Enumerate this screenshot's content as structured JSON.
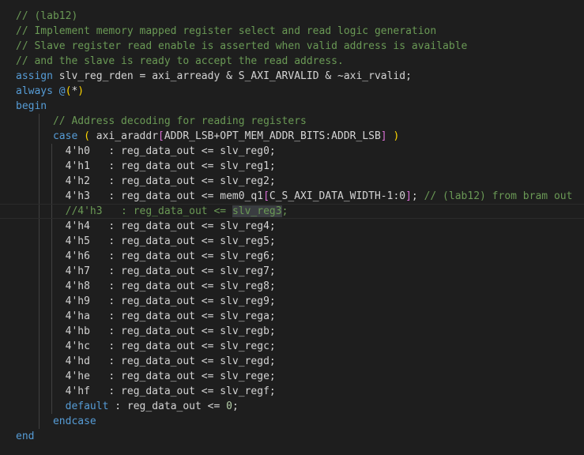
{
  "editor": {
    "lines": [
      {
        "indent": 0,
        "tokens": [
          {
            "t": "// (lab12)",
            "c": "com"
          }
        ]
      },
      {
        "indent": 0,
        "tokens": [
          {
            "t": "// Implement memory mapped register select and read logic generation",
            "c": "com"
          }
        ]
      },
      {
        "indent": 0,
        "tokens": [
          {
            "t": "// Slave register read enable is asserted when valid address is available",
            "c": "com"
          }
        ]
      },
      {
        "indent": 0,
        "tokens": [
          {
            "t": "// and the slave is ready to accept the read address.",
            "c": "com"
          }
        ]
      },
      {
        "indent": 0,
        "tokens": [
          {
            "t": "assign",
            "c": "kw"
          },
          {
            "t": " slv_reg_rden = axi_arready & S_AXI_ARVALID & ~axi_rvalid;",
            "c": "pl"
          }
        ]
      },
      {
        "indent": 0,
        "tokens": [
          {
            "t": "always",
            "c": "kw"
          },
          {
            "t": " ",
            "c": "pl"
          },
          {
            "t": "@",
            "c": "kw"
          },
          {
            "t": "(",
            "c": "br"
          },
          {
            "t": "*",
            "c": "pl"
          },
          {
            "t": ")",
            "c": "br"
          }
        ]
      },
      {
        "indent": 0,
        "tokens": [
          {
            "t": "begin",
            "c": "kw"
          }
        ]
      },
      {
        "indent": 1,
        "tokens": [
          {
            "t": "      // Address decoding for reading registers",
            "c": "com"
          }
        ]
      },
      {
        "indent": 1,
        "tokens": [
          {
            "t": "      ",
            "c": "pl"
          },
          {
            "t": "case",
            "c": "kw"
          },
          {
            "t": " ",
            "c": "pl"
          },
          {
            "t": "(",
            "c": "br"
          },
          {
            "t": " axi_araddr",
            "c": "pl"
          },
          {
            "t": "[",
            "c": "br2"
          },
          {
            "t": "ADDR_LSB+OPT_MEM_ADDR_BITS:ADDR_LSB",
            "c": "pl"
          },
          {
            "t": "]",
            "c": "br2"
          },
          {
            "t": " ",
            "c": "pl"
          },
          {
            "t": ")",
            "c": "br"
          }
        ]
      },
      {
        "indent": 2,
        "tokens": [
          {
            "t": "        4'h0   : reg_data_out <= slv_reg0;",
            "c": "pl"
          }
        ]
      },
      {
        "indent": 2,
        "tokens": [
          {
            "t": "        4'h1   : reg_data_out <= slv_reg1;",
            "c": "pl"
          }
        ]
      },
      {
        "indent": 2,
        "tokens": [
          {
            "t": "        4'h2   : reg_data_out <= slv_reg2;",
            "c": "pl"
          }
        ]
      },
      {
        "indent": 2,
        "tokens": [
          {
            "t": "        4'h3   : reg_data_out <= mem0_q1",
            "c": "pl"
          },
          {
            "t": "[",
            "c": "br2"
          },
          {
            "t": "C_S_AXI_DATA_WIDTH-1:0",
            "c": "pl"
          },
          {
            "t": "]",
            "c": "br2"
          },
          {
            "t": "; ",
            "c": "pl"
          },
          {
            "t": "// (lab12) from bram out",
            "c": "com"
          }
        ]
      },
      {
        "indent": 2,
        "hl": true,
        "tokens": [
          {
            "t": "        //4'h3   : reg_data_out <= ",
            "c": "com"
          },
          {
            "t": "slv_reg3",
            "c": "sel"
          },
          {
            "t": ";",
            "c": "com"
          }
        ]
      },
      {
        "indent": 2,
        "tokens": [
          {
            "t": "        4'h4   : reg_data_out <= slv_reg4;",
            "c": "pl"
          }
        ]
      },
      {
        "indent": 2,
        "tokens": [
          {
            "t": "        4'h5   : reg_data_out <= slv_reg5;",
            "c": "pl"
          }
        ]
      },
      {
        "indent": 2,
        "tokens": [
          {
            "t": "        4'h6   : reg_data_out <= slv_reg6;",
            "c": "pl"
          }
        ]
      },
      {
        "indent": 2,
        "tokens": [
          {
            "t": "        4'h7   : reg_data_out <= slv_reg7;",
            "c": "pl"
          }
        ]
      },
      {
        "indent": 2,
        "tokens": [
          {
            "t": "        4'h8   : reg_data_out <= slv_reg8;",
            "c": "pl"
          }
        ]
      },
      {
        "indent": 2,
        "tokens": [
          {
            "t": "        4'h9   : reg_data_out <= slv_reg9;",
            "c": "pl"
          }
        ]
      },
      {
        "indent": 2,
        "tokens": [
          {
            "t": "        4'ha   : reg_data_out <= slv_rega;",
            "c": "pl"
          }
        ]
      },
      {
        "indent": 2,
        "tokens": [
          {
            "t": "        4'hb   : reg_data_out <= slv_regb;",
            "c": "pl"
          }
        ]
      },
      {
        "indent": 2,
        "tokens": [
          {
            "t": "        4'hc   : reg_data_out <= slv_regc;",
            "c": "pl"
          }
        ]
      },
      {
        "indent": 2,
        "tokens": [
          {
            "t": "        4'hd   : reg_data_out <= slv_regd;",
            "c": "pl"
          }
        ]
      },
      {
        "indent": 2,
        "tokens": [
          {
            "t": "        4'he   : reg_data_out <= slv_rege;",
            "c": "pl"
          }
        ]
      },
      {
        "indent": 2,
        "tokens": [
          {
            "t": "        4'hf   : reg_data_out <= slv_regf;",
            "c": "pl"
          }
        ]
      },
      {
        "indent": 2,
        "tokens": [
          {
            "t": "        ",
            "c": "pl"
          },
          {
            "t": "default",
            "c": "kw"
          },
          {
            "t": " : reg_data_out <= ",
            "c": "pl"
          },
          {
            "t": "0",
            "c": "num"
          },
          {
            "t": ";",
            "c": "pl"
          }
        ]
      },
      {
        "indent": 1,
        "tokens": [
          {
            "t": "      ",
            "c": "pl"
          },
          {
            "t": "endcase",
            "c": "kw"
          }
        ]
      },
      {
        "indent": 0,
        "tokens": [
          {
            "t": "end",
            "c": "kw"
          }
        ]
      }
    ]
  },
  "colors": {
    "background": "#1e1e1e",
    "comment": "#6a9955",
    "keyword": "#569cd6",
    "text": "#d4d4d4",
    "bracket1": "#ffd700",
    "bracket2": "#da70d6",
    "number": "#b5cea8",
    "selection": "#3a3d41"
  }
}
